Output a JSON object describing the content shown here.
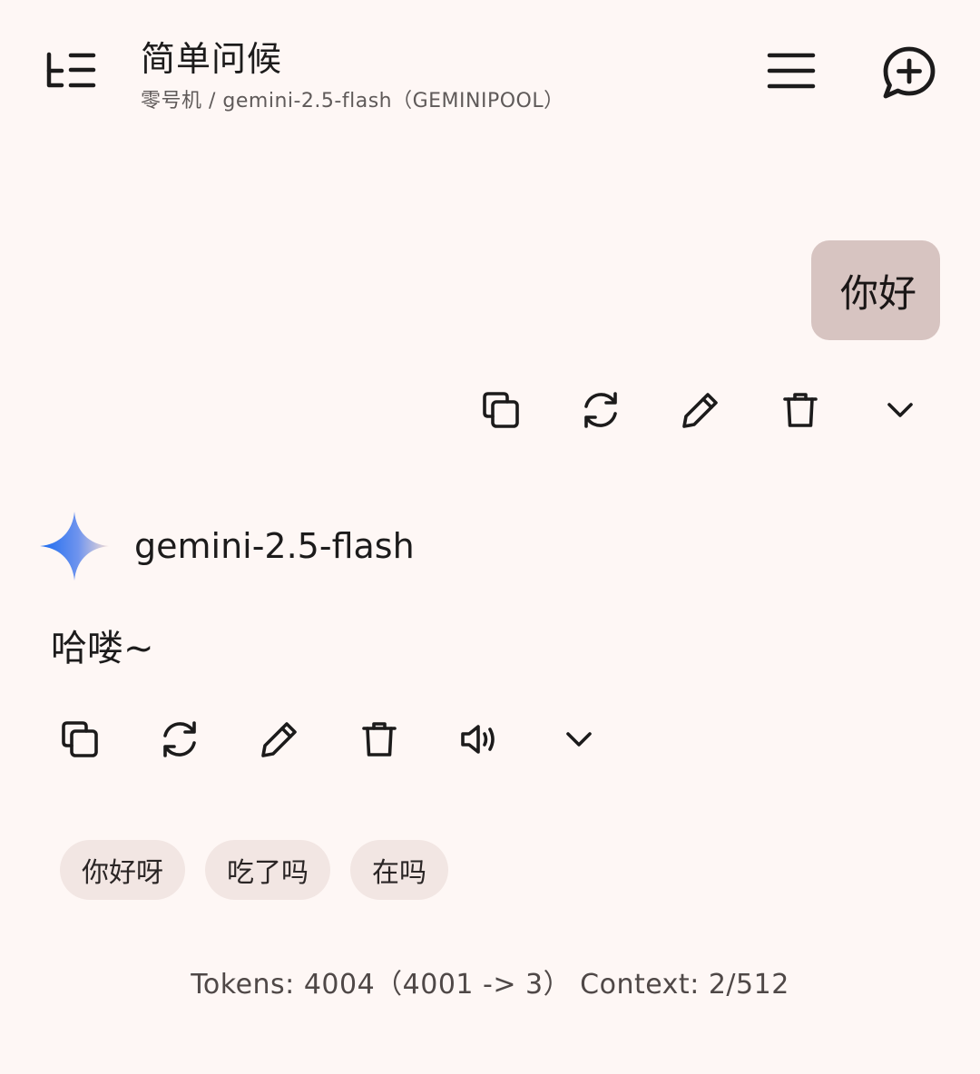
{
  "header": {
    "title": "简单问候",
    "subtitle": "零号机 / gemini-2.5-flash（GEMINIPOOL）"
  },
  "messages": {
    "user_text": "你好",
    "model_name": "gemini-2.5-flash",
    "reply_text": "哈喽~"
  },
  "suggestions": [
    "你好呀",
    "吃了吗",
    "在吗"
  ],
  "footer": {
    "stats": "Tokens: 4004（4001 -> 3） Context: 2/512"
  },
  "icons": {
    "sidebar": "sidebar-toggle-icon",
    "menu": "menu-icon",
    "new_chat": "new-chat-icon",
    "copy": "copy-icon",
    "regenerate": "regenerate-icon",
    "edit": "edit-icon",
    "delete": "delete-icon",
    "speak": "speaker-icon",
    "expand": "chevron-down-icon",
    "model": "gemini-sparkle-icon"
  },
  "colors": {
    "background": "#FEF7F5",
    "user_bubble": "#D7C4C1",
    "chip": "#F2E6E3",
    "sparkle_start": "#1A6BF0",
    "sparkle_end": "#F2DDD6"
  }
}
